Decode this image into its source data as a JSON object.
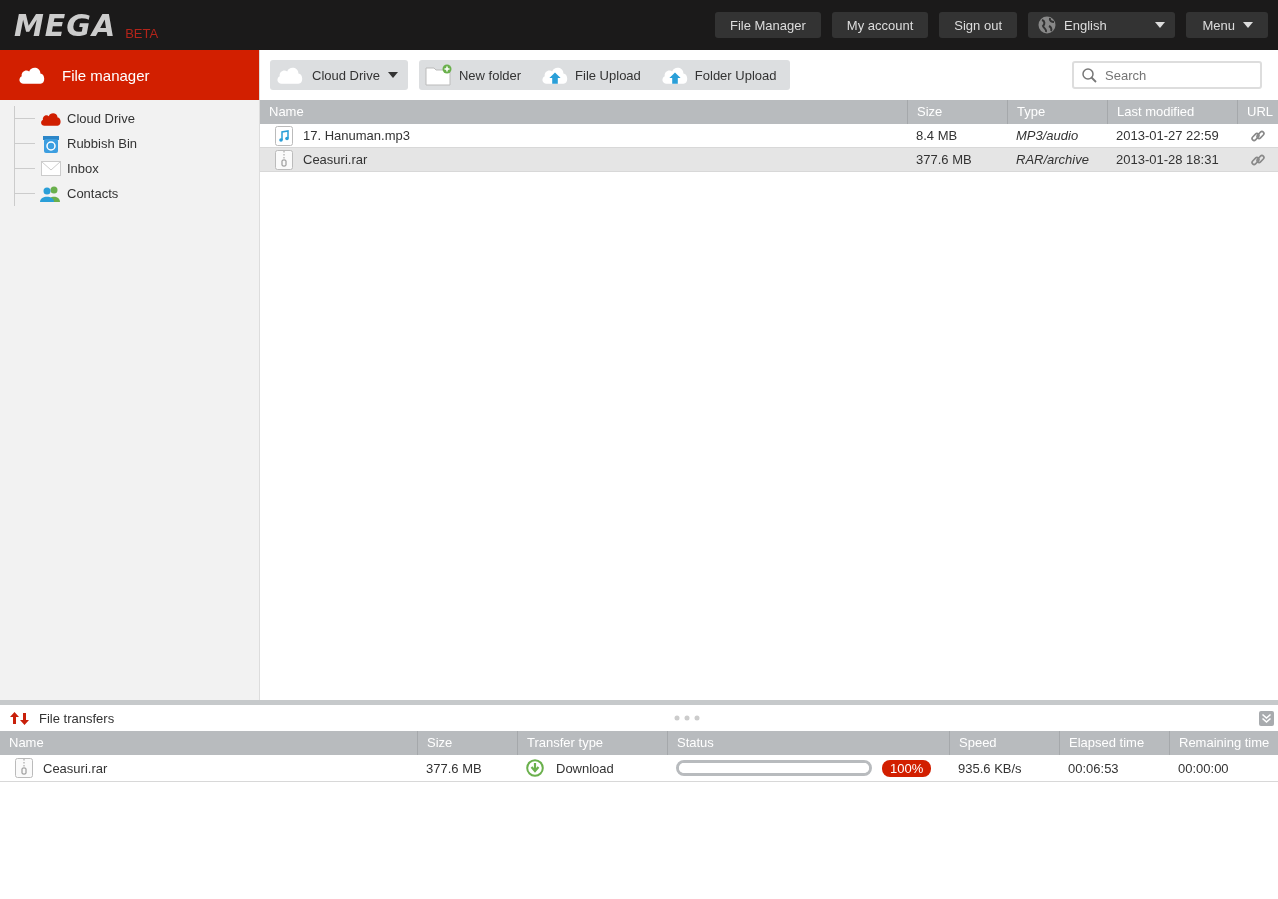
{
  "header": {
    "logo": "MEGA",
    "badge": "BETA",
    "buttons": [
      "File Manager",
      "My account",
      "Sign out"
    ],
    "language": "English",
    "menu": "Menu"
  },
  "sidebar": {
    "title": "File manager",
    "items": [
      {
        "label": "Cloud Drive",
        "kind": "cloud"
      },
      {
        "label": "Rubbish Bin",
        "kind": "bin"
      },
      {
        "label": "Inbox",
        "kind": "inbox"
      },
      {
        "label": "Contacts",
        "kind": "contacts"
      }
    ]
  },
  "toolbar": {
    "location": "Cloud Drive",
    "actions": [
      {
        "label": "New folder",
        "kind": "folder"
      },
      {
        "label": "File Upload",
        "kind": "upload"
      },
      {
        "label": "Folder Upload",
        "kind": "upload"
      }
    ],
    "search": {
      "placeholder": "Search"
    }
  },
  "table": {
    "columns": [
      "Name",
      "Size",
      "Type",
      "Last modified",
      "URL"
    ],
    "rows": [
      {
        "name": "17. Hanuman.mp3",
        "kind": "audio",
        "size": "8.4 MB",
        "type": "MP3/audio",
        "modified": "2013-01-27 22:59",
        "selected": false
      },
      {
        "name": "Ceasuri.rar",
        "kind": "archive",
        "size": "377.6 MB",
        "type": "RAR/archive",
        "modified": "2013-01-28 18:31",
        "selected": true
      }
    ]
  },
  "transfers": {
    "title": "File transfers",
    "columns": [
      "Name",
      "Size",
      "Transfer type",
      "Status",
      "Speed",
      "Elapsed time",
      "Remaining time"
    ],
    "rows": [
      {
        "name": "Ceasuri.rar",
        "kind": "archive",
        "size": "377.6 MB",
        "transfer_type": "Download",
        "level": 1,
        "percent": "100%",
        "speed": "935.6 KB/s",
        "elapsed": "00:06:53",
        "remaining": "00:00:00"
      }
    ]
  }
}
